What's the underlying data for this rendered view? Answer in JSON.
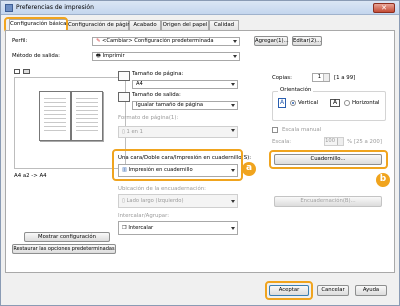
{
  "window": {
    "title": "Preferencias de impresión",
    "close": "✕"
  },
  "tabs": [
    "Configuración básica",
    "Configuración de página",
    "Acabado",
    "Origen del papel",
    "Calidad"
  ],
  "profile": {
    "label": "Perfil:",
    "value": "<Cambiar> Configuración predeterminada",
    "add_button": "Agregar(1)...",
    "edit_button": "Editar(2)..."
  },
  "output_method": {
    "label": "Método de salida:",
    "value": "Imprimir"
  },
  "preview": {
    "caption": "A4 a2 -> A4"
  },
  "page_size": {
    "label": "Tamaño de página:",
    "value": "A4"
  },
  "output_size": {
    "label": "Tamaño de salida:",
    "value": "Igualar tamaño de página"
  },
  "page_format": {
    "label": "Formato de página(1):",
    "value": "1 en 1"
  },
  "copies": {
    "label": "Copias:",
    "value": "1",
    "range": "[1 a 99]"
  },
  "orientation": {
    "label": "Orientación",
    "vertical": "Vertical",
    "horizontal": "Horizontal"
  },
  "manual_scale": {
    "label": "Escala manual",
    "scale_label": "Escala:",
    "scale_value": "100",
    "scale_range": "% [25 a 200]"
  },
  "duplex": {
    "label": "Una cara/Doble cara/Impresión en cuadernillo(S):",
    "value": "Impresión en cuadernillo",
    "button": "Cuadernillo..."
  },
  "binding": {
    "label": "Ubicación de la encuadernación:",
    "value": "Lado largo (Izquierdo)",
    "button": "Encuadernación(B)..."
  },
  "collate": {
    "label": "Intercalar/Agrupar:",
    "value": "Intercalar"
  },
  "left_buttons": {
    "view_settings": "Mostrar configuración",
    "restore_defaults": "Restaurar las opciones predeterminadas"
  },
  "callouts": {
    "a": "a",
    "b": "b"
  },
  "footer": {
    "ok": "Aceptar",
    "cancel": "Cancelar",
    "help": "Ayuda"
  },
  "colors": {
    "highlight": "#f0a41e",
    "accent": "#2a5fb0"
  }
}
